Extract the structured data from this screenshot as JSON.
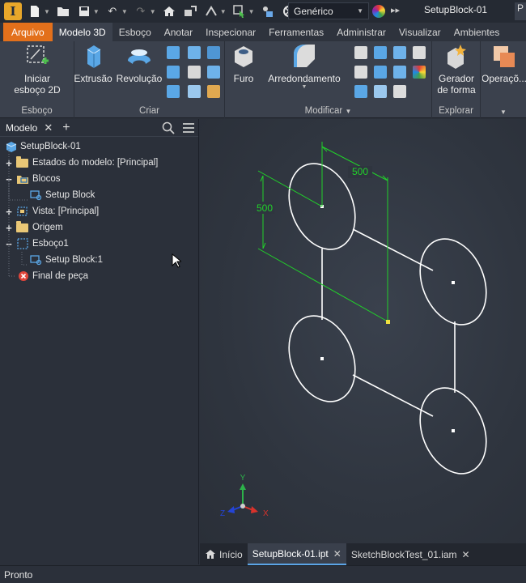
{
  "qat": {
    "app_letter": "I",
    "appearance_value": "Genérico",
    "document_title": "SetupBlock-01",
    "overflow_char": "P"
  },
  "ribbon_tabs": [
    "Arquivo",
    "Modelo 3D",
    "Esboço",
    "Anotar",
    "Inspecionar",
    "Ferramentas",
    "Administrar",
    "Visualizar",
    "Ambientes"
  ],
  "ribbon": {
    "sketch_group": {
      "button_label_1": "Iniciar",
      "button_label_2": "esboço 2D",
      "label": "Esboço"
    },
    "create_group": {
      "extrude_label": "Extrusão",
      "revolve_label": "Revolução",
      "label": "Criar"
    },
    "modify_group": {
      "hole_label": "Furo",
      "fillet_label": "Arredondamento",
      "label": "Modificar"
    },
    "explore_group": {
      "shape_gen_label_1": "Gerador",
      "shape_gen_label_2": "de forma",
      "label": "Explorar"
    },
    "operations_label": "Operaçõ..."
  },
  "browser": {
    "title": "Modelo",
    "items": [
      {
        "label": "SetupBlock-01"
      },
      {
        "label": "Estados do modelo: [Principal]",
        "expander": "+"
      },
      {
        "label": "Blocos",
        "expander": "−"
      },
      {
        "label": "Setup Block"
      },
      {
        "label": "Vista: [Principal]",
        "expander": "+"
      },
      {
        "label": "Origem",
        "expander": "+"
      },
      {
        "label": "Esboço1",
        "expander": "−"
      },
      {
        "label": "Setup Block:1"
      },
      {
        "label": "Final de peça"
      }
    ]
  },
  "viewport": {
    "dim_horizontal": "500",
    "dim_vertical": "500",
    "axis_x": "X",
    "axis_y": "Y",
    "axis_z": "Z",
    "dimension_color": "#21d12a",
    "sketch_color": "#ffffff"
  },
  "doc_tabs": [
    {
      "label": "Início"
    },
    {
      "label": "SetupBlock-01.ipt"
    },
    {
      "label": "SketchBlockTest_01.iam"
    }
  ],
  "status": {
    "text": "Pronto"
  }
}
